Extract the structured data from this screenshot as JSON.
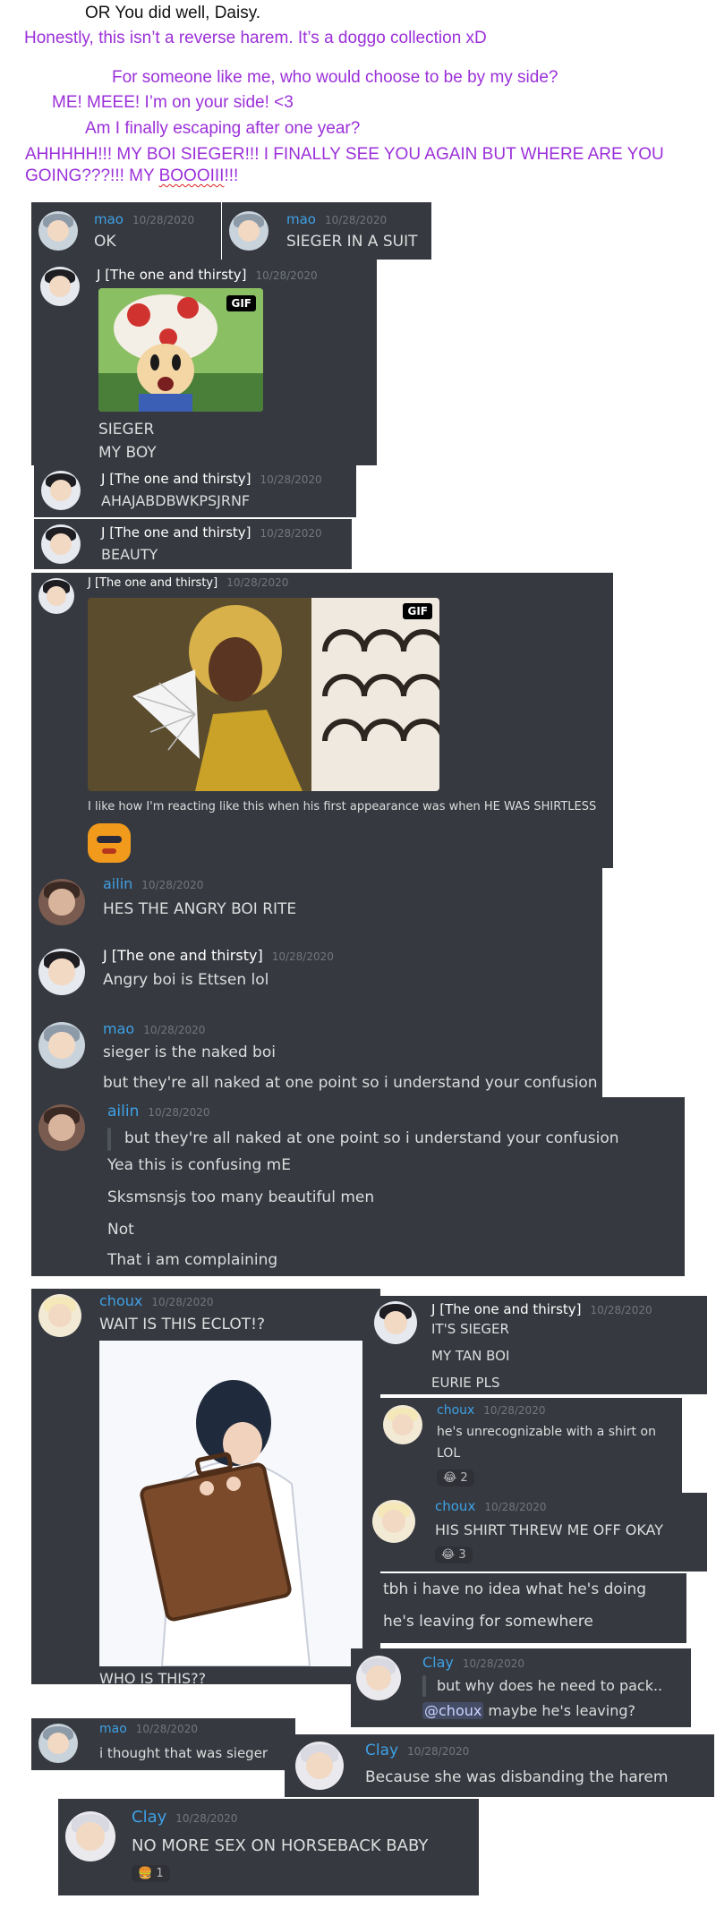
{
  "notes": {
    "line1": "OR You did well, Daisy.",
    "line2": "Honestly, this isn’t a reverse harem. It’s a doggo collection xD",
    "line3": "For someone like me, who would choose to be by my side?",
    "line4": "ME! MEEE! I’m on your side! <3",
    "line5": "Am I finally escaping after one year?",
    "line6": "AHHHHH!!! MY BOI SIEGER!!! I FINALLY SEE YOU AGAIN BUT WHERE ARE YOU",
    "line7a": "GOING???!!! MY ",
    "line7b": "BOOOIII",
    "line7c": "!!!"
  },
  "messages": {
    "m1": {
      "user": "mao",
      "ts": "10/28/2020",
      "text": "OK"
    },
    "m2": {
      "user": "mao",
      "ts": "10/28/2020",
      "text": "SIEGER IN A SUIT"
    },
    "m3": {
      "user": "J [The one and thirsty]",
      "ts": "10/28/2020",
      "gif": "GIF",
      "l1": "SIEGER",
      "l2": "MY BOY"
    },
    "m4": {
      "user": "J [The one and thirsty]",
      "ts": "10/28/2020",
      "text": "AHAJABDBWKPSJRNF"
    },
    "m5": {
      "user": "J [The one and thirsty]",
      "ts": "10/28/2020",
      "text": "BEAUTY"
    },
    "m6": {
      "user": "J [The one and thirsty]",
      "ts": "10/28/2020",
      "gif": "GIF",
      "text": "I like how I'm reacting like this when his first appearance was when HE WAS SHIRTLESS"
    },
    "m7": {
      "user": "ailin",
      "ts": "10/28/2020",
      "text": "HES THE ANGRY BOI RITE"
    },
    "m8": {
      "user": "J [The one and thirsty]",
      "ts": "10/28/2020",
      "text": "Angry boi is Ettsen lol"
    },
    "m9": {
      "user": "mao",
      "ts": "10/28/2020",
      "l1": "sieger is the naked boi",
      "l2": "but they're all naked at one point so i understand your confusion"
    },
    "m10": {
      "user": "ailin",
      "ts": "10/28/2020",
      "quote": "but they're all naked at one point so i understand your confusion",
      "l1": "Yea this is confusing mE",
      "l2": "Sksmsnsjs too many beautiful men",
      "l3": "Not",
      "l4": "That i am complaining"
    },
    "m11": {
      "user": "choux",
      "ts": "10/28/2020",
      "l1": "WAIT IS THIS ECLOT!?",
      "l2": "WHO IS THIS??"
    },
    "m12": {
      "user": "J [The one and thirsty]",
      "ts": "10/28/2020",
      "l1": "IT'S SIEGER",
      "l2": "MY TAN BOI",
      "l3": "EURIE PLS"
    },
    "m13": {
      "user": "choux",
      "ts": "10/28/2020",
      "l1": "he's unrecognizable with a shirt on",
      "l2": "LOL",
      "reaction": "2"
    },
    "m14": {
      "user": "choux",
      "ts": "10/28/2020",
      "text": "HIS SHIRT THREW ME OFF OKAY",
      "reaction": "3"
    },
    "m15": {
      "l1": "tbh i have no idea what he's doing",
      "l2": "he's leaving for somewhere"
    },
    "m16": {
      "user": "Clay",
      "ts": "10/28/2020",
      "l1": "but why does he need to pack..",
      "mention": "@choux",
      "l2": " maybe he's leaving?"
    },
    "m17": {
      "user": "mao",
      "ts": "10/28/2020",
      "text": "i thought that was sieger"
    },
    "m18": {
      "user": "Clay",
      "ts": "10/28/2020",
      "text": "Because she was disbanding the harem"
    },
    "m19": {
      "user": "Clay",
      "ts": "10/28/2020",
      "text": "NO MORE SEX ON HORSEBACK BABY",
      "reaction": "1"
    }
  },
  "colors": {
    "card": "#36393f",
    "note_purple": "#9b30d9",
    "username_blue": "#3ea1e6",
    "timestamp": "#72767d",
    "text": "#dcddde"
  }
}
